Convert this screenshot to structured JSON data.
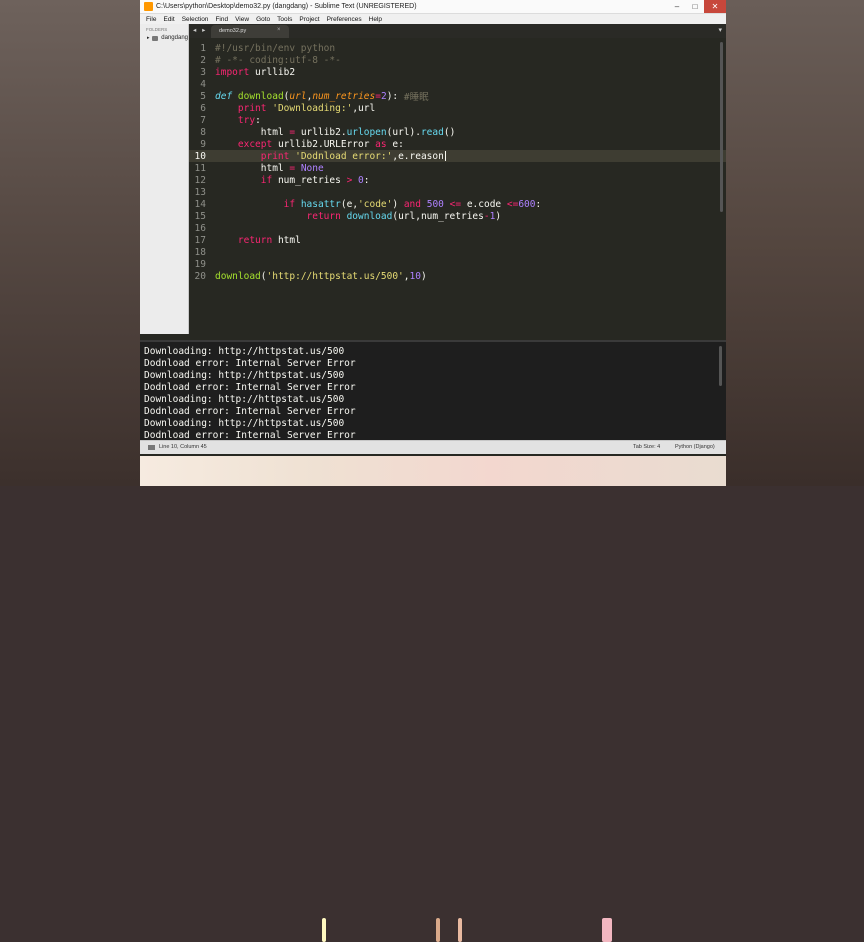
{
  "window": {
    "title": "C:\\Users\\python\\Desktop\\demo32.py (dangdang) - Sublime Text (UNREGISTERED)",
    "minimize": "–",
    "maximize": "□",
    "close": "✕"
  },
  "menu": [
    "File",
    "Edit",
    "Selection",
    "Find",
    "View",
    "Goto",
    "Tools",
    "Project",
    "Preferences",
    "Help"
  ],
  "sidebar": {
    "folders_label": "FOLDERS",
    "folder_name": "dangdang"
  },
  "tabs": {
    "nav": "◂ ▸",
    "active_tab": "demo32.py",
    "close_glyph": "×",
    "dropdown": "▾"
  },
  "code_lines": [
    {
      "n": "1",
      "tokens": [
        {
          "t": "#!/usr/bin/env python",
          "c": "cm"
        }
      ]
    },
    {
      "n": "2",
      "tokens": [
        {
          "t": "# -*- coding:utf-8 -*-",
          "c": "cm"
        }
      ]
    },
    {
      "n": "3",
      "tokens": [
        {
          "t": "import",
          "c": "kw"
        },
        {
          "t": " urllib2",
          "c": "tx"
        }
      ]
    },
    {
      "n": "4",
      "tokens": []
    },
    {
      "n": "5",
      "tokens": [
        {
          "t": "def",
          "c": "st2"
        },
        {
          "t": " ",
          "c": "tx"
        },
        {
          "t": "download",
          "c": "fn"
        },
        {
          "t": "(",
          "c": "tx"
        },
        {
          "t": "url",
          "c": "pa"
        },
        {
          "t": ",",
          "c": "tx"
        },
        {
          "t": "num_retries",
          "c": "pa"
        },
        {
          "t": "=",
          "c": "kw"
        },
        {
          "t": "2",
          "c": "nu"
        },
        {
          "t": "): ",
          "c": "tx"
        },
        {
          "t": "#睡眠",
          "c": "cm"
        }
      ]
    },
    {
      "n": "6",
      "tokens": [
        {
          "t": "    ",
          "c": "tx"
        },
        {
          "t": "print",
          "c": "kw"
        },
        {
          "t": " ",
          "c": "tx"
        },
        {
          "t": "'Downloading:'",
          "c": "st"
        },
        {
          "t": ",url",
          "c": "tx"
        }
      ]
    },
    {
      "n": "7",
      "tokens": [
        {
          "t": "    ",
          "c": "tx"
        },
        {
          "t": "try",
          "c": "kw"
        },
        {
          "t": ":",
          "c": "tx"
        }
      ]
    },
    {
      "n": "8",
      "tokens": [
        {
          "t": "        html ",
          "c": "tx"
        },
        {
          "t": "=",
          "c": "kw"
        },
        {
          "t": " urllib2.",
          "c": "tx"
        },
        {
          "t": "urlopen",
          "c": "bi"
        },
        {
          "t": "(url).",
          "c": "tx"
        },
        {
          "t": "read",
          "c": "bi"
        },
        {
          "t": "()",
          "c": "tx"
        }
      ]
    },
    {
      "n": "9",
      "tokens": [
        {
          "t": "    ",
          "c": "tx"
        },
        {
          "t": "except",
          "c": "kw"
        },
        {
          "t": " urllib2.URLError ",
          "c": "tx"
        },
        {
          "t": "as",
          "c": "kw"
        },
        {
          "t": " e:",
          "c": "tx"
        }
      ]
    },
    {
      "n": "10",
      "tokens": [
        {
          "t": "        ",
          "c": "tx"
        },
        {
          "t": "print",
          "c": "kw"
        },
        {
          "t": " ",
          "c": "tx"
        },
        {
          "t": "'Dodnload error:'",
          "c": "st"
        },
        {
          "t": ",e.reason",
          "c": "tx"
        }
      ],
      "highlight": true
    },
    {
      "n": "11",
      "tokens": [
        {
          "t": "        html ",
          "c": "tx"
        },
        {
          "t": "=",
          "c": "kw"
        },
        {
          "t": " ",
          "c": "tx"
        },
        {
          "t": "None",
          "c": "nu"
        }
      ]
    },
    {
      "n": "12",
      "tokens": [
        {
          "t": "        ",
          "c": "tx"
        },
        {
          "t": "if",
          "c": "kw"
        },
        {
          "t": " num_retries ",
          "c": "tx"
        },
        {
          "t": ">",
          "c": "kw"
        },
        {
          "t": " ",
          "c": "tx"
        },
        {
          "t": "0",
          "c": "nu"
        },
        {
          "t": ":",
          "c": "tx"
        }
      ]
    },
    {
      "n": "13",
      "tokens": []
    },
    {
      "n": "14",
      "tokens": [
        {
          "t": "            ",
          "c": "tx"
        },
        {
          "t": "if",
          "c": "kw"
        },
        {
          "t": " ",
          "c": "tx"
        },
        {
          "t": "hasattr",
          "c": "bi"
        },
        {
          "t": "(e,",
          "c": "tx"
        },
        {
          "t": "'code'",
          "c": "st"
        },
        {
          "t": ") ",
          "c": "tx"
        },
        {
          "t": "and",
          "c": "kw"
        },
        {
          "t": " ",
          "c": "tx"
        },
        {
          "t": "500",
          "c": "nu"
        },
        {
          "t": " ",
          "c": "tx"
        },
        {
          "t": "<=",
          "c": "kw"
        },
        {
          "t": " e.code ",
          "c": "tx"
        },
        {
          "t": "<=",
          "c": "kw"
        },
        {
          "t": "600",
          "c": "nu"
        },
        {
          "t": ":",
          "c": "tx"
        }
      ]
    },
    {
      "n": "15",
      "tokens": [
        {
          "t": "                ",
          "c": "tx"
        },
        {
          "t": "return",
          "c": "kw"
        },
        {
          "t": " ",
          "c": "tx"
        },
        {
          "t": "download",
          "c": "bi"
        },
        {
          "t": "(url,num_retries",
          "c": "tx"
        },
        {
          "t": "-",
          "c": "kw"
        },
        {
          "t": "1",
          "c": "nu"
        },
        {
          "t": ")",
          "c": "tx"
        }
      ]
    },
    {
      "n": "16",
      "tokens": []
    },
    {
      "n": "17",
      "tokens": [
        {
          "t": "    ",
          "c": "tx"
        },
        {
          "t": "return",
          "c": "kw"
        },
        {
          "t": " html",
          "c": "tx"
        }
      ]
    },
    {
      "n": "18",
      "tokens": []
    },
    {
      "n": "19",
      "tokens": []
    },
    {
      "n": "20",
      "tokens": [
        {
          "t": "download",
          "c": "fn"
        },
        {
          "t": "(",
          "c": "tx"
        },
        {
          "t": "'http://httpstat.us/500'",
          "c": "st"
        },
        {
          "t": ",",
          "c": "tx"
        },
        {
          "t": "10",
          "c": "nu"
        },
        {
          "t": ")",
          "c": "tx"
        }
      ]
    }
  ],
  "console_lines": [
    "Downloading: http://httpstat.us/500",
    "Dodnload error: Internal Server Error",
    "Downloading: http://httpstat.us/500",
    "Dodnload error: Internal Server Error",
    "Downloading: http://httpstat.us/500",
    "Dodnload error: Internal Server Error",
    "Downloading: http://httpstat.us/500",
    "Dodnload error: Internal Server Error"
  ],
  "status": {
    "position": "Line 10, Column 45",
    "tab_size": "Tab Size: 4",
    "syntax": "Python (Django)"
  },
  "colors": {
    "editor_bg": "#272822",
    "keyword": "#f92672",
    "string": "#e6db74",
    "number": "#ae81ff",
    "function": "#a6e22e",
    "builtin": "#66d9ef",
    "comment": "#75715e",
    "param": "#fd971f"
  }
}
